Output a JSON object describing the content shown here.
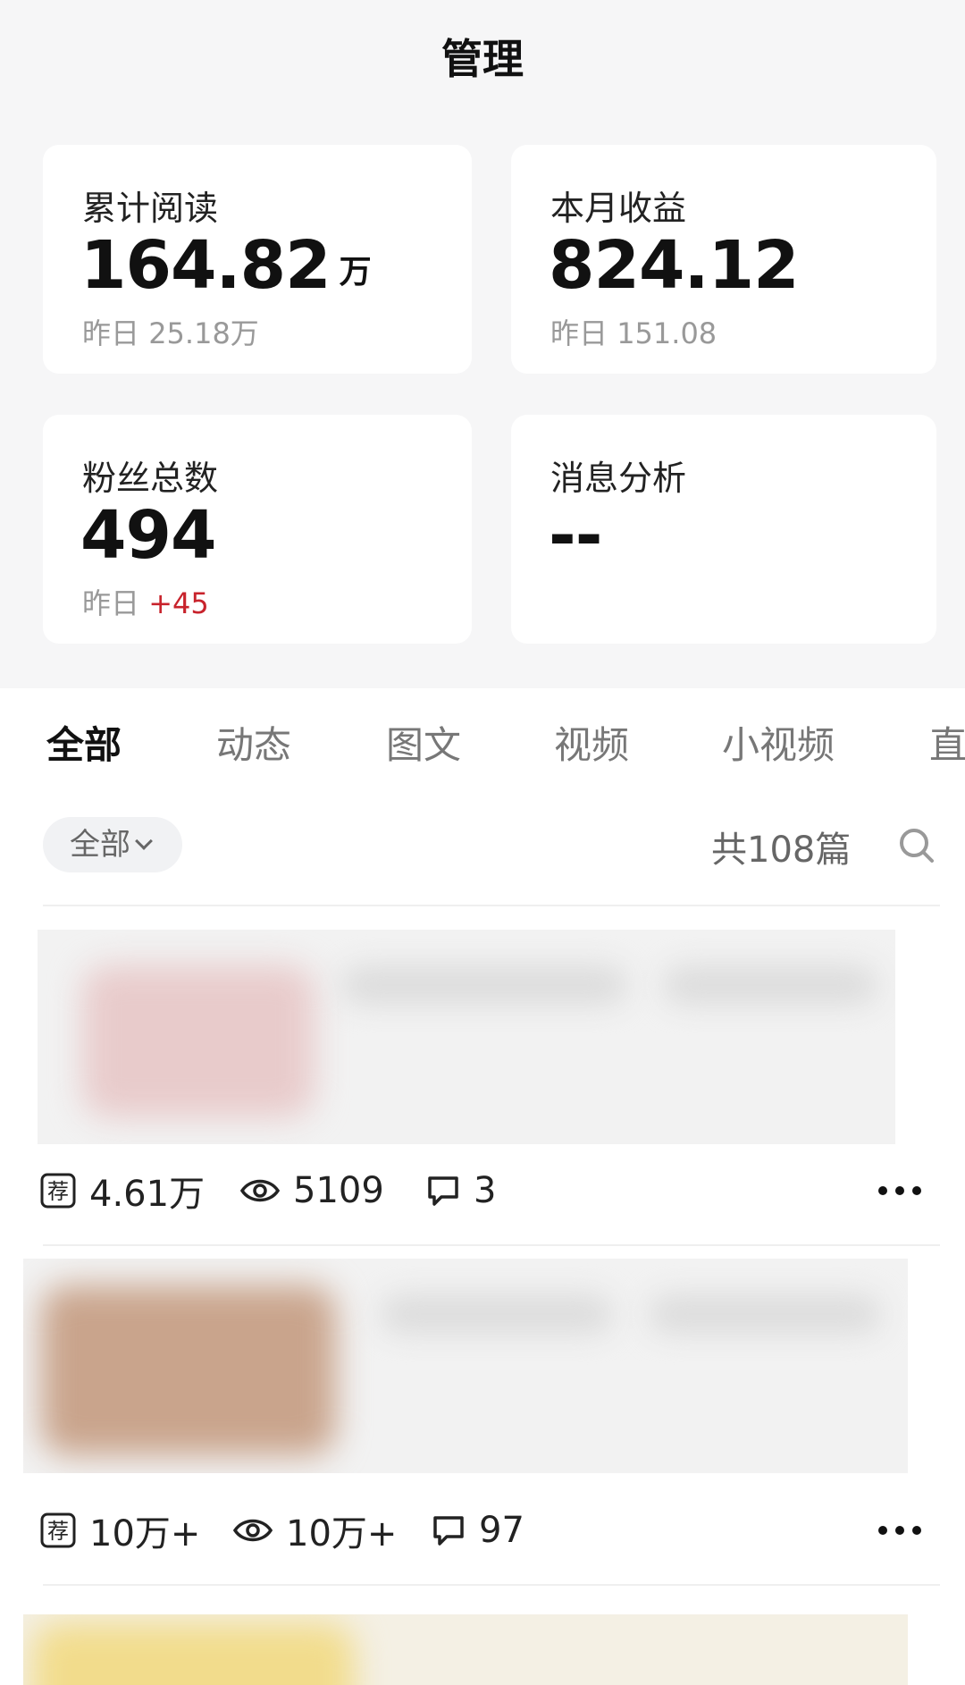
{
  "header": {
    "title": "管理"
  },
  "cards": [
    {
      "label": "累计阅读",
      "value": "164.82",
      "unit": "万",
      "sub_prefix": "昨日",
      "sub_value": "25.18万"
    },
    {
      "label": "本月收益",
      "value": "824.12",
      "sub_prefix": "昨日",
      "sub_value": "151.08"
    },
    {
      "label": "粉丝总数",
      "value": "494",
      "sub_prefix": "昨日",
      "sub_delta": "+45"
    },
    {
      "label": "消息分析",
      "value": "--"
    }
  ],
  "tabs": [
    "全部",
    "动态",
    "图文",
    "视频",
    "小视频",
    "直"
  ],
  "filter": {
    "label": "全部",
    "total": "共108篇"
  },
  "articles": [
    {
      "recommend": "4.61万",
      "views": "5109",
      "comments": "3"
    },
    {
      "recommend": "10万+",
      "views": "10万+",
      "comments": "97"
    }
  ],
  "colors": {
    "delta_red": "#c8232c",
    "page_bg": "#f6f6f7"
  },
  "icons": [
    "recommend-icon",
    "eye-icon",
    "comment-icon",
    "more-icon",
    "search-icon",
    "chevron-down-icon"
  ]
}
